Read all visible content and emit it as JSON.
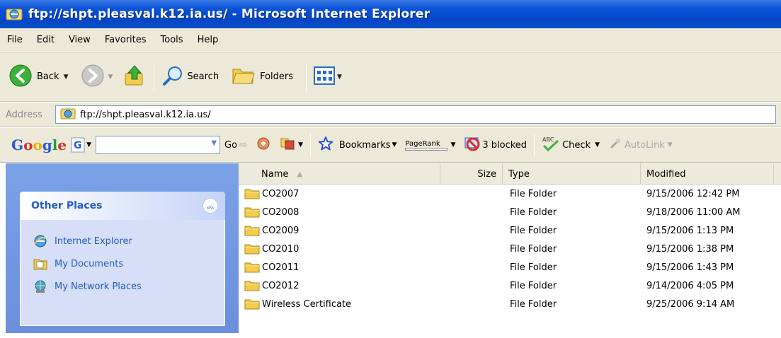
{
  "window": {
    "title": "ftp://shpt.pleasval.k12.ia.us/ - Microsoft Internet Explorer"
  },
  "menu": [
    "File",
    "Edit",
    "View",
    "Favorites",
    "Tools",
    "Help"
  ],
  "toolbar": {
    "back_label": "Back",
    "search_label": "Search",
    "folders_label": "Folders"
  },
  "address": {
    "label": "Address",
    "value": "ftp://shpt.pleasval.k12.ia.us/"
  },
  "google_toolbar": {
    "logo": "Google",
    "go_label": "Go",
    "bookmarks_label": "Bookmarks",
    "pagerank_label": "PageRank",
    "blocked_label": "3 blocked",
    "check_label": "Check",
    "autolink_label": "AutoLink"
  },
  "sidebar": {
    "title": "Other Places",
    "items": [
      {
        "label": "Internet Explorer",
        "icon": "internet-explorer-icon"
      },
      {
        "label": "My Documents",
        "icon": "my-documents-icon"
      },
      {
        "label": "My Network Places",
        "icon": "network-places-icon"
      }
    ]
  },
  "columns": {
    "name": "Name",
    "size": "Size",
    "type": "Type",
    "modified": "Modified"
  },
  "files": [
    {
      "name": "CO2007",
      "size": "",
      "type": "File Folder",
      "modified": "9/15/2006 12:42 PM"
    },
    {
      "name": "CO2008",
      "size": "",
      "type": "File Folder",
      "modified": "9/18/2006 11:00 AM"
    },
    {
      "name": "CO2009",
      "size": "",
      "type": "File Folder",
      "modified": "9/15/2006 1:13 PM"
    },
    {
      "name": "CO2010",
      "size": "",
      "type": "File Folder",
      "modified": "9/15/2006 1:38 PM"
    },
    {
      "name": "CO2011",
      "size": "",
      "type": "File Folder",
      "modified": "9/15/2006 1:43 PM"
    },
    {
      "name": "CO2012",
      "size": "",
      "type": "File Folder",
      "modified": "9/14/2006 4:05 PM"
    },
    {
      "name": "Wireless Certificate",
      "size": "",
      "type": "File Folder",
      "modified": "9/25/2006 9:14 AM"
    }
  ],
  "colors": {
    "title_bar": "#0a53d8",
    "sidebar_bg": "#6c8fdc",
    "link": "#215dc6",
    "chrome": "#ece9d8"
  }
}
